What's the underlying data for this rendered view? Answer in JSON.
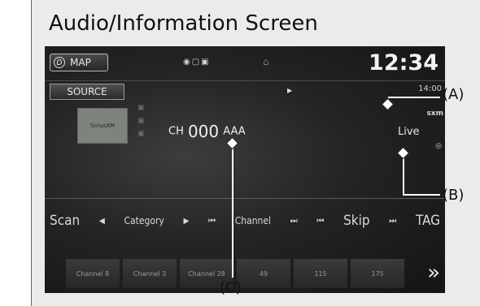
{
  "caption": "Audio/Information Screen",
  "screen": {
    "map_label": "MAP",
    "clock": "12:34",
    "source_label": "SOURCE",
    "freq_hint": "14:00",
    "sxm_label": "sxm",
    "live_label": "Live",
    "channel_prefix": "CH",
    "channel_number": "000",
    "channel_name": "AAA",
    "logo_text": "SiriusXM",
    "controls": {
      "scan": "Scan",
      "category": "Category",
      "channel": "Channel",
      "skip": "Skip",
      "tag": "TAG"
    },
    "presets": [
      "Channel 8",
      "Channel 3",
      "Channel 28",
      "49",
      "115",
      "175"
    ]
  },
  "callouts": {
    "a": "(A)",
    "b": "(B)",
    "c": "(C)"
  }
}
